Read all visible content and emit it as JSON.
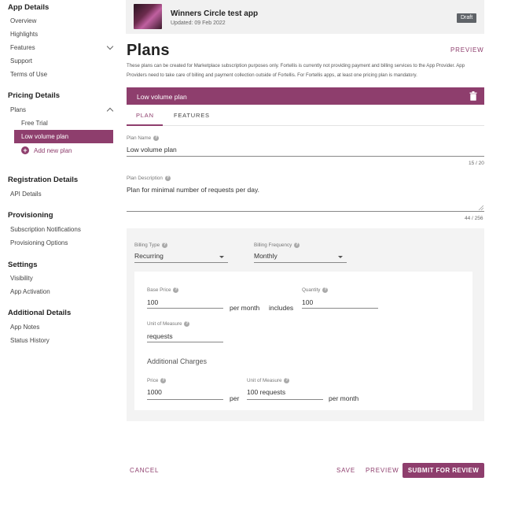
{
  "sidebar": {
    "app_details": {
      "title": "App Details",
      "items": [
        "Overview",
        "Highlights",
        "Features",
        "Support",
        "Terms of Use"
      ]
    },
    "pricing_details": {
      "title": "Pricing Details",
      "plans_label": "Plans",
      "plans": [
        "Free Trial",
        "Low volume plan"
      ],
      "add_new_plan": "Add new plan"
    },
    "registration_details": {
      "title": "Registration Details",
      "items": [
        "API Details"
      ]
    },
    "provisioning": {
      "title": "Provisioning",
      "items": [
        "Subscription Notifications",
        "Provisioning Options"
      ]
    },
    "settings": {
      "title": "Settings",
      "items": [
        "Visibility",
        "App Activation"
      ]
    },
    "additional_details": {
      "title": "Additional Details",
      "items": [
        "App Notes",
        "Status History"
      ]
    }
  },
  "app": {
    "name": "Winners Circle test app",
    "updated": "Updated: 09 Feb 2022",
    "status": "Draft"
  },
  "page": {
    "title": "Plans",
    "preview_link": "PREVIEW",
    "description": "These plans can be created for Marketplace subscription purposes only. Fortellis is currently not providing payment and billing services to the App Provider. App Providers need to take care of billing and payment collection outside of Fortellis. For Fortellis apps, at least one pricing plan is mandatory."
  },
  "plan": {
    "header_title": "Low volume plan",
    "tabs": [
      "PLAN",
      "FEATURES"
    ],
    "name_label": "Plan Name",
    "name_value": "Low volume plan",
    "name_counter": "15 / 20",
    "description_label": "Plan Description",
    "description_value": "Plan for minimal number of requests per day.",
    "description_counter": "44 / 256"
  },
  "billing": {
    "type_label": "Billing Type",
    "type_value": "Recurring",
    "frequency_label": "Billing Frequency",
    "frequency_value": "Monthly",
    "base_price_label": "Base Price",
    "base_price_value": "100",
    "per_month": "per month",
    "includes": "includes",
    "quantity_label": "Quantity",
    "quantity_value": "100",
    "unit_label": "Unit of Measure",
    "unit_value": "requests",
    "additional_charges_title": "Additional Charges",
    "price_label": "Price",
    "price_value": "1000",
    "per": "per",
    "add_unit_label": "Unit of Measure",
    "add_unit_value": "100 requests",
    "per_month_2": "per month"
  },
  "footer": {
    "cancel": "CANCEL",
    "save": "SAVE",
    "preview": "PREVIEW",
    "submit": "SUBMIT FOR REVIEW"
  },
  "colors": {
    "accent": "#8e3e6d",
    "panel_bg": "#f3f3f3",
    "badge_bg": "#5f6368"
  }
}
